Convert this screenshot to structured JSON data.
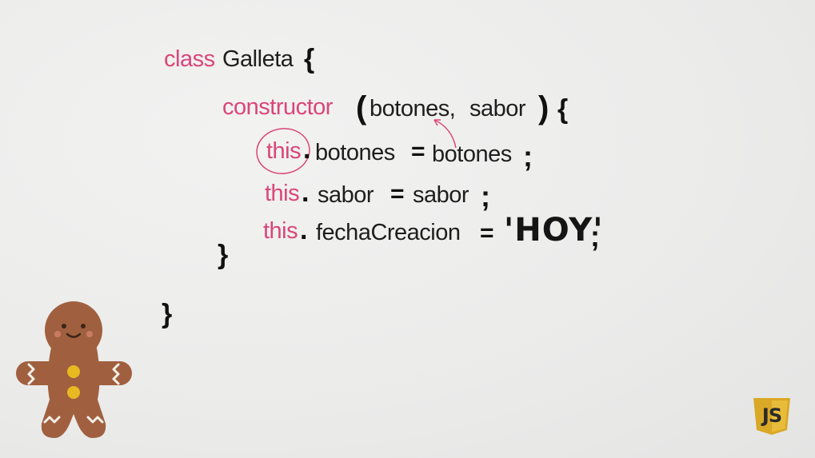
{
  "code": {
    "class_keyword": "class",
    "class_name": "Galleta",
    "open_brace": "{",
    "constructor_keyword": "constructor",
    "open_paren": "(",
    "param1": "botones,",
    "param2": "sabor",
    "close_paren": ")",
    "constructor_open_brace": "{",
    "line1": {
      "this": "this",
      "dot": ".",
      "prop": "botones",
      "eq": "=",
      "value": "botones",
      "semi": ";"
    },
    "line2": {
      "this": "this",
      "dot": ".",
      "prop": "sabor",
      "eq": "=",
      "value": "sabor",
      "semi": ";"
    },
    "line3": {
      "this": "this",
      "dot": ".",
      "prop": "fechaCreacion",
      "eq": "=",
      "value": "'HOY'",
      "semi": ";"
    },
    "constructor_close_brace": "}",
    "class_close_brace": "}"
  },
  "logo": {
    "text": "JS",
    "color": "#d9a826"
  },
  "colors": {
    "keyword": "#d9467a",
    "text": "#1e1e1e",
    "background": "#ededec",
    "cookie": "#a0603f"
  },
  "icons": [
    "gingerbread-man-icon",
    "js-logo-icon",
    "arrow-annotation-icon",
    "circle-annotation-icon"
  ]
}
